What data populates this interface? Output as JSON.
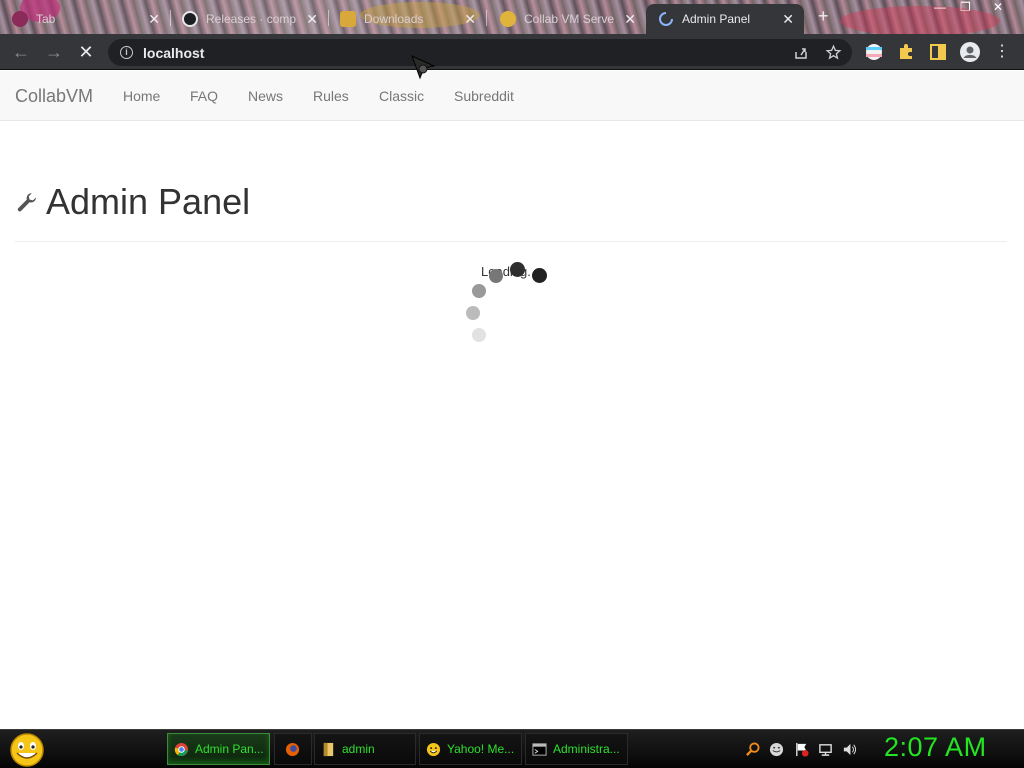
{
  "browser": {
    "tabs": [
      {
        "label": "Tab",
        "close": "✕"
      },
      {
        "label": "Releases · comp",
        "close": "✕"
      },
      {
        "label": "Downloads",
        "close": "✕"
      },
      {
        "label": "Collab VM Serve",
        "close": "✕"
      },
      {
        "label": "Admin Panel",
        "close": "✕"
      }
    ],
    "new_tab": "+",
    "window_controls": {
      "minimize": "—",
      "restore": "❐",
      "close": "✕"
    },
    "toolbar": {
      "back": "←",
      "forward": "→",
      "reload": "✕",
      "url": "localhost"
    }
  },
  "site": {
    "brand": "CollabVM",
    "nav": [
      "Home",
      "FAQ",
      "News",
      "Rules",
      "Classic",
      "Subreddit"
    ],
    "page_title": "Admin Panel",
    "loading_text": "Loading..."
  },
  "taskbar": {
    "tasks": [
      {
        "label": "Admin Pan...",
        "icon": "chrome-icon"
      },
      {
        "label": "",
        "icon": "firefox-icon"
      },
      {
        "label": "admin",
        "icon": "folder-icon"
      },
      {
        "label": "Yahoo! Me...",
        "icon": "yahoo-messenger-icon"
      },
      {
        "label": "Administra...",
        "icon": "cmd-icon"
      }
    ],
    "clock": "2:07 AM"
  },
  "colors": {
    "accent_green": "#22e622",
    "navbar_bg": "#f8f8f8",
    "tab_active_bg": "#35363a"
  }
}
